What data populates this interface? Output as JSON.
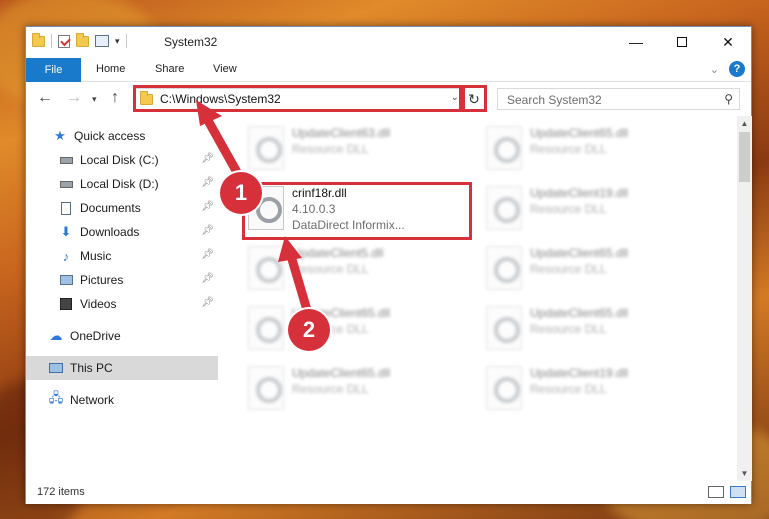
{
  "window": {
    "title": "System32",
    "minimize_icon": "minimize-icon",
    "maximize_icon": "maximize-icon",
    "close_icon": "close-icon"
  },
  "ribbon": {
    "tabs": [
      "File",
      "Home",
      "Share",
      "View"
    ],
    "help": "?"
  },
  "nav": {
    "address": "C:\\Windows\\System32",
    "search_placeholder": "Search System32"
  },
  "sidebar": {
    "items": [
      {
        "label": "Quick access",
        "icon": "star-icon"
      },
      {
        "label": "Local Disk (C:)",
        "icon": "drive-icon",
        "pinned": true
      },
      {
        "label": "Local Disk (D:)",
        "icon": "drive-icon",
        "pinned": true
      },
      {
        "label": "Documents",
        "icon": "documents-icon",
        "pinned": true
      },
      {
        "label": "Downloads",
        "icon": "downloads-icon",
        "pinned": true
      },
      {
        "label": "Music",
        "icon": "music-icon",
        "pinned": true
      },
      {
        "label": "Pictures",
        "icon": "pictures-icon",
        "pinned": true
      },
      {
        "label": "Videos",
        "icon": "videos-icon",
        "pinned": true
      },
      {
        "label": "OneDrive",
        "icon": "cloud-icon"
      },
      {
        "label": "This PC",
        "icon": "computer-icon",
        "selected": true
      },
      {
        "label": "Network",
        "icon": "network-icon"
      }
    ]
  },
  "files": {
    "col1": [
      {
        "name": "UpdateClient63.dll",
        "desc": "Resource DLL"
      },
      {
        "name": "crinf18r.dll",
        "version": "4.10.0.3",
        "desc": "DataDirect Informix..."
      },
      {
        "name": "UpdateClient5.dll",
        "desc": "Resource DLL"
      },
      {
        "name": "UpdateClient65.dll",
        "desc": "Resource DLL"
      },
      {
        "name": "UpdateClient65.dll",
        "desc": "Resource DLL"
      }
    ],
    "col2": [
      {
        "name": "UpdateClient65.dll",
        "desc": "Resource DLL"
      },
      {
        "name": "UpdateClient19.dll",
        "desc": "Resource DLL"
      },
      {
        "name": "UpdateClient65.dll",
        "desc": "Resource DLL"
      },
      {
        "name": "UpdateClient65.dll",
        "desc": "Resource DLL"
      },
      {
        "name": "UpdateClient19.dll",
        "desc": "Resource DLL"
      }
    ]
  },
  "status": {
    "count": "172 items"
  },
  "annotations": {
    "marker1": "1",
    "marker2": "2",
    "color": "#d6303b"
  }
}
